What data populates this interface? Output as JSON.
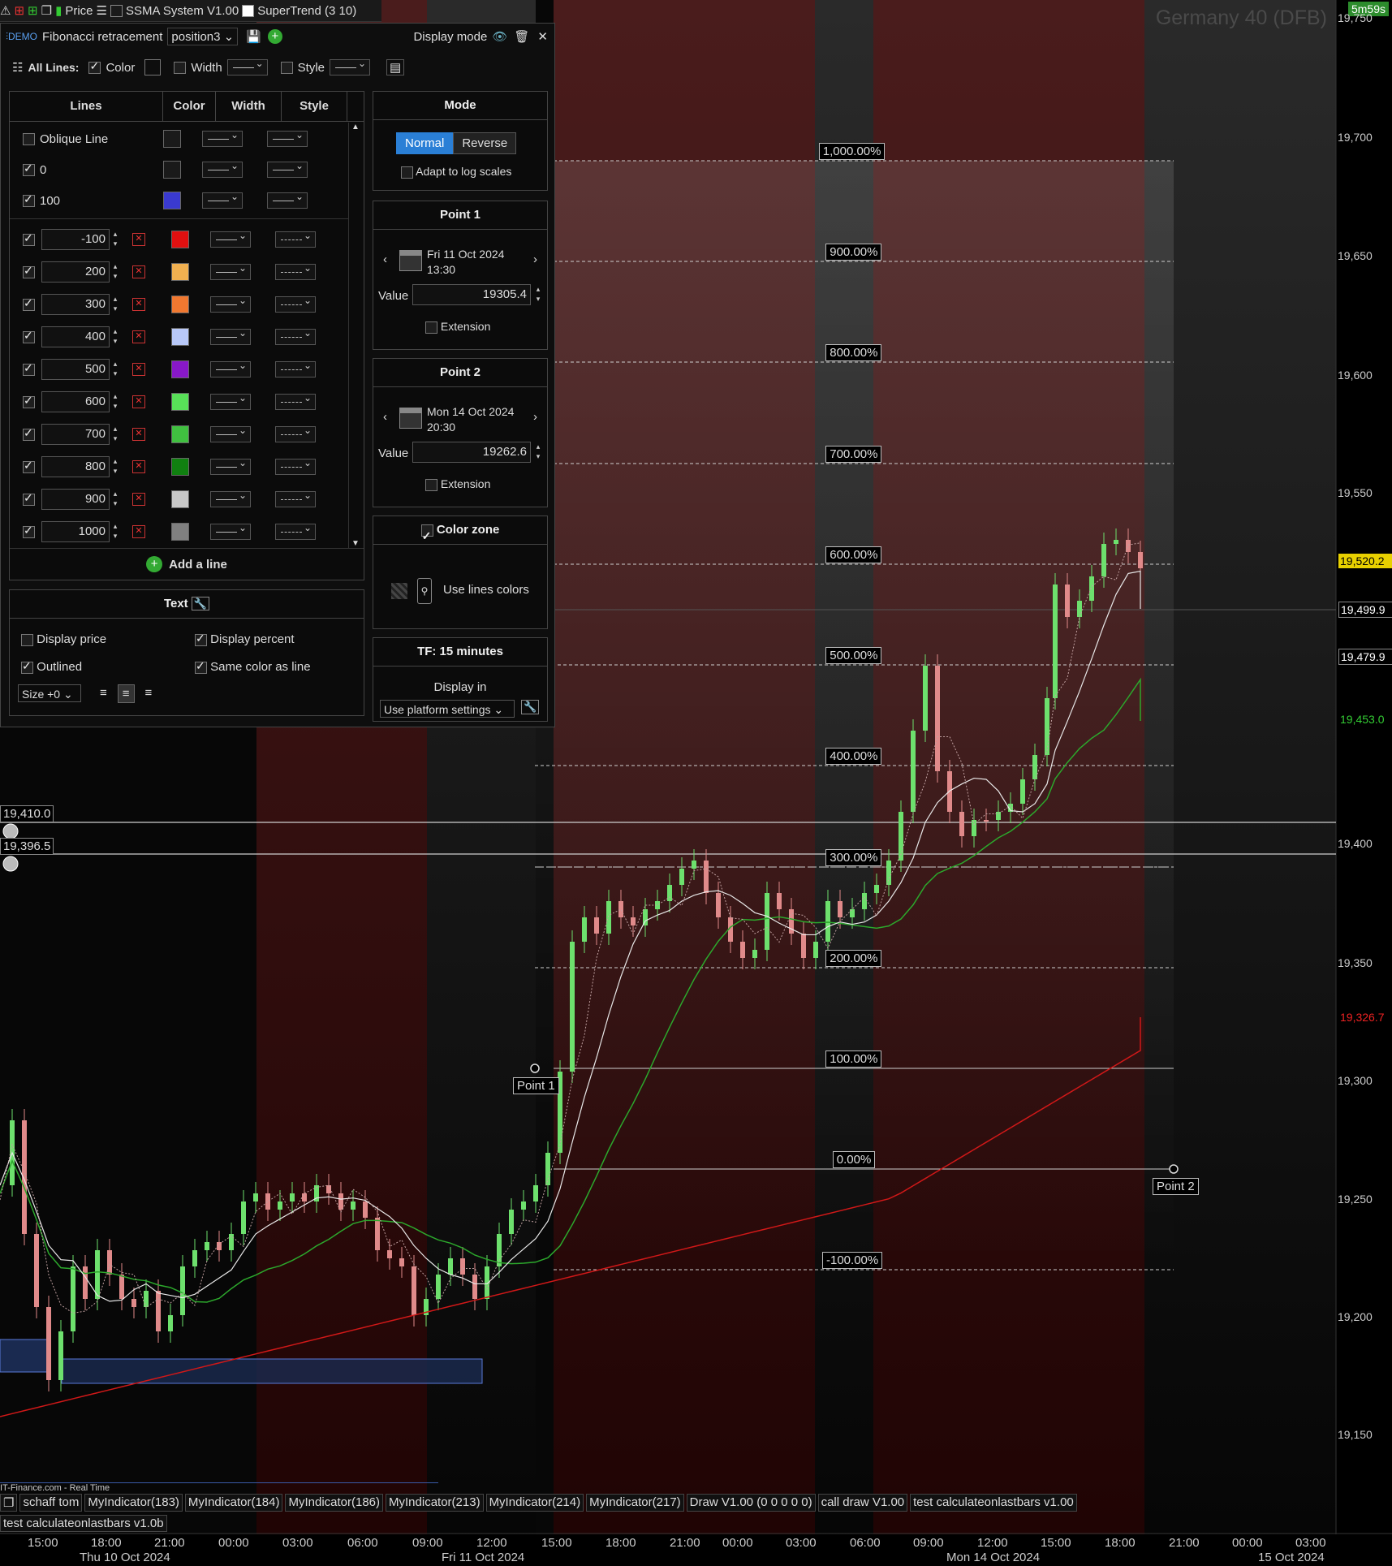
{
  "topbar": {
    "price_label": "Price",
    "ind1": "SSMA System V1.00",
    "ind2": "SuperTrend (3 10)"
  },
  "timer": "5m59s",
  "instrument": "Germany 40 (DFB)",
  "panel": {
    "title": "Fibonacci retracement",
    "preset": "position3",
    "display_mode": "Display mode",
    "all_lines_label": "All Lines:",
    "color_label": "Color",
    "width_label": "Width",
    "style_label": "Style",
    "table_headers": {
      "lines": "Lines",
      "color": "Color",
      "width": "Width",
      "style": "Style"
    },
    "fixed_rows": [
      {
        "label": "Oblique Line",
        "checked": false,
        "color": "#1a1a1a"
      },
      {
        "label": "0",
        "checked": true,
        "color": "#1a1a1a"
      },
      {
        "label": "100",
        "checked": true,
        "color": "#3a3ad0"
      }
    ],
    "levels": [
      {
        "value": "-100",
        "color": "#e01010",
        "style": "dash"
      },
      {
        "value": "200",
        "color": "#f0b050",
        "style": "dash"
      },
      {
        "value": "300",
        "color": "#f07830",
        "style": "dash"
      },
      {
        "value": "400",
        "color": "#b8c8f8",
        "style": "dash"
      },
      {
        "value": "500",
        "color": "#8818c8",
        "style": "dash"
      },
      {
        "value": "600",
        "color": "#58e058",
        "style": "dash"
      },
      {
        "value": "700",
        "color": "#40c040",
        "style": "dash"
      },
      {
        "value": "800",
        "color": "#108010",
        "style": "dash"
      },
      {
        "value": "900",
        "color": "#c8c8c8",
        "style": "dash"
      },
      {
        "value": "1000",
        "color": "#808080",
        "style": "dash"
      }
    ],
    "add_line": "Add a line",
    "text_section": {
      "title": "Text",
      "display_price": "Display price",
      "display_percent": "Display percent",
      "outlined": "Outlined",
      "same_color": "Same color as line",
      "size": "Size +0"
    },
    "mode": {
      "title": "Mode",
      "normal": "Normal",
      "reverse": "Reverse",
      "adapt": "Adapt to log scales"
    },
    "point1": {
      "title": "Point 1",
      "date": "Fri 11 Oct 2024",
      "time": "13:30",
      "value_label": "Value",
      "value": "19305.4",
      "extension": "Extension"
    },
    "point2": {
      "title": "Point 2",
      "date": "Mon 14 Oct 2024",
      "time": "20:30",
      "value_label": "Value",
      "value": "19262.6",
      "extension": "Extension"
    },
    "color_zone": {
      "title": "Color zone",
      "use_lines": "Use lines colors"
    },
    "tf": {
      "title": "TF: 15 minutes",
      "display_in": "Display in",
      "platform": "Use platform settings"
    }
  },
  "fib_labels": [
    "1,000.00%",
    "900.00%",
    "800.00%",
    "700.00%",
    "600.00%",
    "500.00%",
    "400.00%",
    "300.00%",
    "200.00%",
    "100.00%",
    "0.00%",
    "-100.00%"
  ],
  "point_labels": {
    "p1": "Point 1",
    "p2": "Point 2"
  },
  "price_axis": [
    "19,750",
    "19,700",
    "19,650",
    "19,600",
    "19,550",
    "19,400",
    "19,350",
    "19,300",
    "19,250",
    "19,200",
    "19,150"
  ],
  "price_tags": {
    "last": "19,520.2",
    "t1": "19,499.9",
    "t2": "19,479.9",
    "green": "19,453.0",
    "red": "19,326.7"
  },
  "hlines": {
    "a": "19,410.0",
    "b": "19,396.5"
  },
  "time_axis": [
    "15:00",
    "18:00",
    "21:00",
    "00:00",
    "03:00",
    "06:00",
    "09:00",
    "12:00",
    "15:00",
    "18:00",
    "21:00",
    "00:00",
    "03:00",
    "06:00",
    "09:00",
    "12:00",
    "15:00",
    "18:00",
    "21:00",
    "00:00",
    "03:00"
  ],
  "date_axis": [
    "Thu 10 Oct 2024",
    "Fri 11 Oct 2024",
    "Mon 14 Oct 2024",
    "15 Oct 2024"
  ],
  "source": "IT-Finance.com - Real Time",
  "indicators": [
    "schaff tom",
    "MyIndicator(183)",
    "MyIndicator(184)",
    "MyIndicator(186)",
    "MyIndicator(213)",
    "MyIndicator(214)",
    "MyIndicator(217)",
    "Draw V1.00 (0 0 0 0 0)",
    "call draw V1.00",
    "test calculateonlastbars v1.00"
  ],
  "indicator2": "test calculateonlastbars v1.0b"
}
